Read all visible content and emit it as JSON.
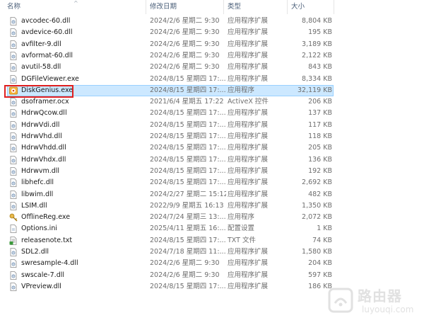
{
  "columns": {
    "name": "名称",
    "date": "修改日期",
    "type": "类型",
    "size": "大小"
  },
  "files": [
    {
      "name": "avcodec-60.dll",
      "date": "2024/2/6 星期二 9:30",
      "type": "应用程序扩展",
      "size": "8,804 KB",
      "icon": "dll-icon"
    },
    {
      "name": "avdevice-60.dll",
      "date": "2024/2/6 星期二 9:30",
      "type": "应用程序扩展",
      "size": "195 KB",
      "icon": "dll-icon"
    },
    {
      "name": "avfilter-9.dll",
      "date": "2024/2/6 星期二 9:30",
      "type": "应用程序扩展",
      "size": "3,189 KB",
      "icon": "dll-icon"
    },
    {
      "name": "avformat-60.dll",
      "date": "2024/2/6 星期二 9:30",
      "type": "应用程序扩展",
      "size": "2,122 KB",
      "icon": "dll-icon"
    },
    {
      "name": "avutil-58.dll",
      "date": "2024/2/6 星期二 9:30",
      "type": "应用程序扩展",
      "size": "843 KB",
      "icon": "dll-icon"
    },
    {
      "name": "DGFileViewer.exe",
      "date": "2024/8/15 星期四 17:...",
      "type": "应用程序扩展",
      "size": "8,334 KB",
      "icon": "dll-icon"
    },
    {
      "name": "DiskGenius.exe",
      "date": "2024/8/15 星期四 17:...",
      "type": "应用程序",
      "size": "32,119 KB",
      "icon": "exe-icon"
    },
    {
      "name": "dsoframer.ocx",
      "date": "2021/6/4 星期五 17:22",
      "type": "ActiveX 控件",
      "size": "206 KB",
      "icon": "dll-icon"
    },
    {
      "name": "HdrwQcow.dll",
      "date": "2024/8/15 星期四 17:...",
      "type": "应用程序扩展",
      "size": "137 KB",
      "icon": "dll-icon"
    },
    {
      "name": "HdrwVdi.dll",
      "date": "2024/8/15 星期四 17:...",
      "type": "应用程序扩展",
      "size": "117 KB",
      "icon": "dll-icon"
    },
    {
      "name": "HdrwVhd.dll",
      "date": "2024/8/15 星期四 17:...",
      "type": "应用程序扩展",
      "size": "118 KB",
      "icon": "dll-icon"
    },
    {
      "name": "HdrwVhdd.dll",
      "date": "2024/8/15 星期四 17:...",
      "type": "应用程序扩展",
      "size": "205 KB",
      "icon": "dll-icon"
    },
    {
      "name": "HdrwVhdx.dll",
      "date": "2024/8/15 星期四 17:...",
      "type": "应用程序扩展",
      "size": "136 KB",
      "icon": "dll-icon"
    },
    {
      "name": "Hdrwvm.dll",
      "date": "2024/8/15 星期四 17:...",
      "type": "应用程序扩展",
      "size": "192 KB",
      "icon": "dll-icon"
    },
    {
      "name": "libhefc.dll",
      "date": "2024/8/15 星期四 17:...",
      "type": "应用程序扩展",
      "size": "2,692 KB",
      "icon": "dll-icon"
    },
    {
      "name": "libwim.dll",
      "date": "2024/2/27 星期二 15:12",
      "type": "应用程序扩展",
      "size": "482 KB",
      "icon": "dll-icon"
    },
    {
      "name": "LSIM.dll",
      "date": "2022/9/9 星期五 16:13",
      "type": "应用程序扩展",
      "size": "1,350 KB",
      "icon": "dll-icon"
    },
    {
      "name": "OfflineReg.exe",
      "date": "2024/7/24 星期三 13:...",
      "type": "应用程序",
      "size": "2,072 KB",
      "icon": "key-exe-icon"
    },
    {
      "name": "Options.ini",
      "date": "2025/4/11 星期五 16:...",
      "type": "配置设置",
      "size": "1 KB",
      "icon": "ini-icon"
    },
    {
      "name": "releasenote.txt",
      "date": "2024/8/15 星期四 17:...",
      "type": "TXT 文件",
      "size": "74 KB",
      "icon": "txt-icon"
    },
    {
      "name": "SDL2.dll",
      "date": "2024/7/18 星期四 11:...",
      "type": "应用程序扩展",
      "size": "1,580 KB",
      "icon": "dll-icon"
    },
    {
      "name": "swresample-4.dll",
      "date": "2024/2/6 星期二 9:30",
      "type": "应用程序扩展",
      "size": "204 KB",
      "icon": "dll-icon"
    },
    {
      "name": "swscale-7.dll",
      "date": "2024/2/6 星期二 9:30",
      "type": "应用程序扩展",
      "size": "597 KB",
      "icon": "dll-icon"
    },
    {
      "name": "VPreview.dll",
      "date": "2024/8/15 星期四 17:...",
      "type": "应用程序扩展",
      "size": "186 KB",
      "icon": "dll-icon"
    }
  ],
  "selected_file": "DiskGenius.exe",
  "watermark": {
    "text": "路由器",
    "sub": "luyouqi.com"
  },
  "colors": {
    "selection": "#cce8ff",
    "highlight_border": "#e02020",
    "header_text": "#4c607a"
  }
}
